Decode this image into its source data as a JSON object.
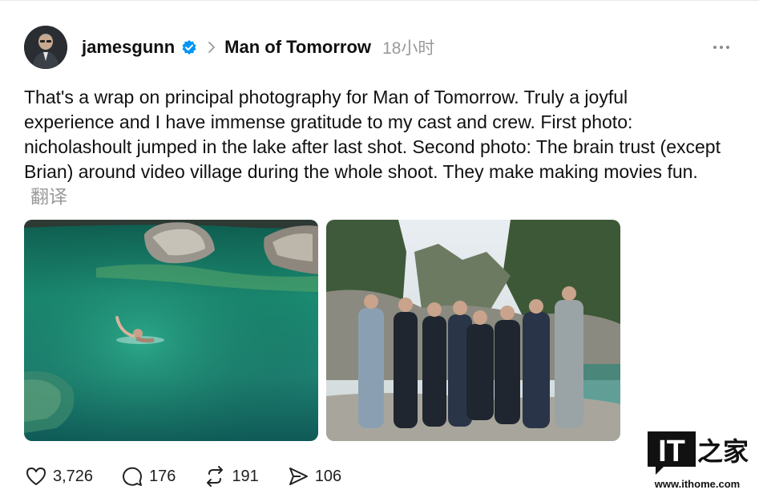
{
  "post": {
    "author": "jamesgunn",
    "community": "Man of Tomorrow",
    "timestamp": "18小时",
    "text": "That's a wrap on principal photography for Man of Tomorrow. Truly a joyful experience and I have immense gratitude to my cast and crew. First photo: nicholashoult jumped in the lake after last shot. Second photo: The brain trust (except Brian) around video village during the whole shoot. They make making movies fun.",
    "translate_label": "翻译"
  },
  "actions": {
    "likes": "3,726",
    "replies": "176",
    "reposts": "191",
    "shares": "106"
  },
  "watermark": {
    "logo_text": "IT",
    "logo_cn": "之家",
    "url": "www.ithome.com"
  },
  "colors": {
    "verified_blue": "#0095f6",
    "muted_gray": "#999999",
    "lake_green": "#1f8f7a"
  },
  "icons": {
    "verified": "verified-badge-icon",
    "chevron": "chevron-right-icon",
    "more": "more-horizontal-icon",
    "like": "heart-icon",
    "reply": "comment-icon",
    "repost": "repost-icon",
    "share": "send-icon"
  }
}
